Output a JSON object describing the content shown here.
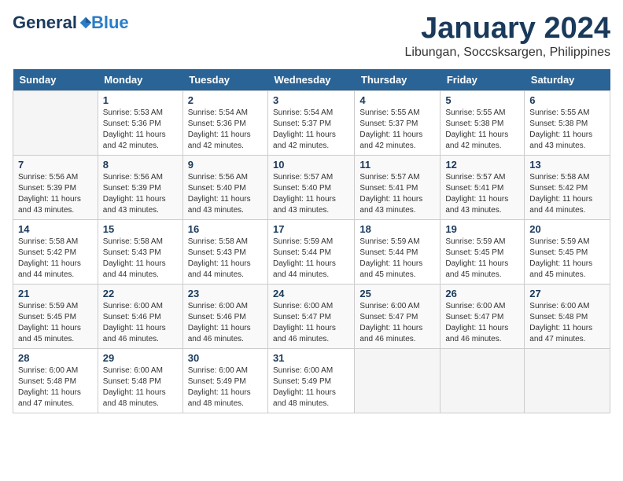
{
  "logo": {
    "general": "General",
    "blue": "Blue"
  },
  "title": "January 2024",
  "location": "Libungan, Soccsksargen, Philippines",
  "days_header": [
    "Sunday",
    "Monday",
    "Tuesday",
    "Wednesday",
    "Thursday",
    "Friday",
    "Saturday"
  ],
  "weeks": [
    [
      {
        "day": "",
        "info": ""
      },
      {
        "day": "1",
        "info": "Sunrise: 5:53 AM\nSunset: 5:36 PM\nDaylight: 11 hours\nand 42 minutes."
      },
      {
        "day": "2",
        "info": "Sunrise: 5:54 AM\nSunset: 5:36 PM\nDaylight: 11 hours\nand 42 minutes."
      },
      {
        "day": "3",
        "info": "Sunrise: 5:54 AM\nSunset: 5:37 PM\nDaylight: 11 hours\nand 42 minutes."
      },
      {
        "day": "4",
        "info": "Sunrise: 5:55 AM\nSunset: 5:37 PM\nDaylight: 11 hours\nand 42 minutes."
      },
      {
        "day": "5",
        "info": "Sunrise: 5:55 AM\nSunset: 5:38 PM\nDaylight: 11 hours\nand 42 minutes."
      },
      {
        "day": "6",
        "info": "Sunrise: 5:55 AM\nSunset: 5:38 PM\nDaylight: 11 hours\nand 43 minutes."
      }
    ],
    [
      {
        "day": "7",
        "info": "Sunrise: 5:56 AM\nSunset: 5:39 PM\nDaylight: 11 hours\nand 43 minutes."
      },
      {
        "day": "8",
        "info": "Sunrise: 5:56 AM\nSunset: 5:39 PM\nDaylight: 11 hours\nand 43 minutes."
      },
      {
        "day": "9",
        "info": "Sunrise: 5:56 AM\nSunset: 5:40 PM\nDaylight: 11 hours\nand 43 minutes."
      },
      {
        "day": "10",
        "info": "Sunrise: 5:57 AM\nSunset: 5:40 PM\nDaylight: 11 hours\nand 43 minutes."
      },
      {
        "day": "11",
        "info": "Sunrise: 5:57 AM\nSunset: 5:41 PM\nDaylight: 11 hours\nand 43 minutes."
      },
      {
        "day": "12",
        "info": "Sunrise: 5:57 AM\nSunset: 5:41 PM\nDaylight: 11 hours\nand 43 minutes."
      },
      {
        "day": "13",
        "info": "Sunrise: 5:58 AM\nSunset: 5:42 PM\nDaylight: 11 hours\nand 44 minutes."
      }
    ],
    [
      {
        "day": "14",
        "info": "Sunrise: 5:58 AM\nSunset: 5:42 PM\nDaylight: 11 hours\nand 44 minutes."
      },
      {
        "day": "15",
        "info": "Sunrise: 5:58 AM\nSunset: 5:43 PM\nDaylight: 11 hours\nand 44 minutes."
      },
      {
        "day": "16",
        "info": "Sunrise: 5:58 AM\nSunset: 5:43 PM\nDaylight: 11 hours\nand 44 minutes."
      },
      {
        "day": "17",
        "info": "Sunrise: 5:59 AM\nSunset: 5:44 PM\nDaylight: 11 hours\nand 44 minutes."
      },
      {
        "day": "18",
        "info": "Sunrise: 5:59 AM\nSunset: 5:44 PM\nDaylight: 11 hours\nand 45 minutes."
      },
      {
        "day": "19",
        "info": "Sunrise: 5:59 AM\nSunset: 5:45 PM\nDaylight: 11 hours\nand 45 minutes."
      },
      {
        "day": "20",
        "info": "Sunrise: 5:59 AM\nSunset: 5:45 PM\nDaylight: 11 hours\nand 45 minutes."
      }
    ],
    [
      {
        "day": "21",
        "info": "Sunrise: 5:59 AM\nSunset: 5:45 PM\nDaylight: 11 hours\nand 45 minutes."
      },
      {
        "day": "22",
        "info": "Sunrise: 6:00 AM\nSunset: 5:46 PM\nDaylight: 11 hours\nand 46 minutes."
      },
      {
        "day": "23",
        "info": "Sunrise: 6:00 AM\nSunset: 5:46 PM\nDaylight: 11 hours\nand 46 minutes."
      },
      {
        "day": "24",
        "info": "Sunrise: 6:00 AM\nSunset: 5:47 PM\nDaylight: 11 hours\nand 46 minutes."
      },
      {
        "day": "25",
        "info": "Sunrise: 6:00 AM\nSunset: 5:47 PM\nDaylight: 11 hours\nand 46 minutes."
      },
      {
        "day": "26",
        "info": "Sunrise: 6:00 AM\nSunset: 5:47 PM\nDaylight: 11 hours\nand 46 minutes."
      },
      {
        "day": "27",
        "info": "Sunrise: 6:00 AM\nSunset: 5:48 PM\nDaylight: 11 hours\nand 47 minutes."
      }
    ],
    [
      {
        "day": "28",
        "info": "Sunrise: 6:00 AM\nSunset: 5:48 PM\nDaylight: 11 hours\nand 47 minutes."
      },
      {
        "day": "29",
        "info": "Sunrise: 6:00 AM\nSunset: 5:48 PM\nDaylight: 11 hours\nand 48 minutes."
      },
      {
        "day": "30",
        "info": "Sunrise: 6:00 AM\nSunset: 5:49 PM\nDaylight: 11 hours\nand 48 minutes."
      },
      {
        "day": "31",
        "info": "Sunrise: 6:00 AM\nSunset: 5:49 PM\nDaylight: 11 hours\nand 48 minutes."
      },
      {
        "day": "",
        "info": ""
      },
      {
        "day": "",
        "info": ""
      },
      {
        "day": "",
        "info": ""
      }
    ]
  ]
}
